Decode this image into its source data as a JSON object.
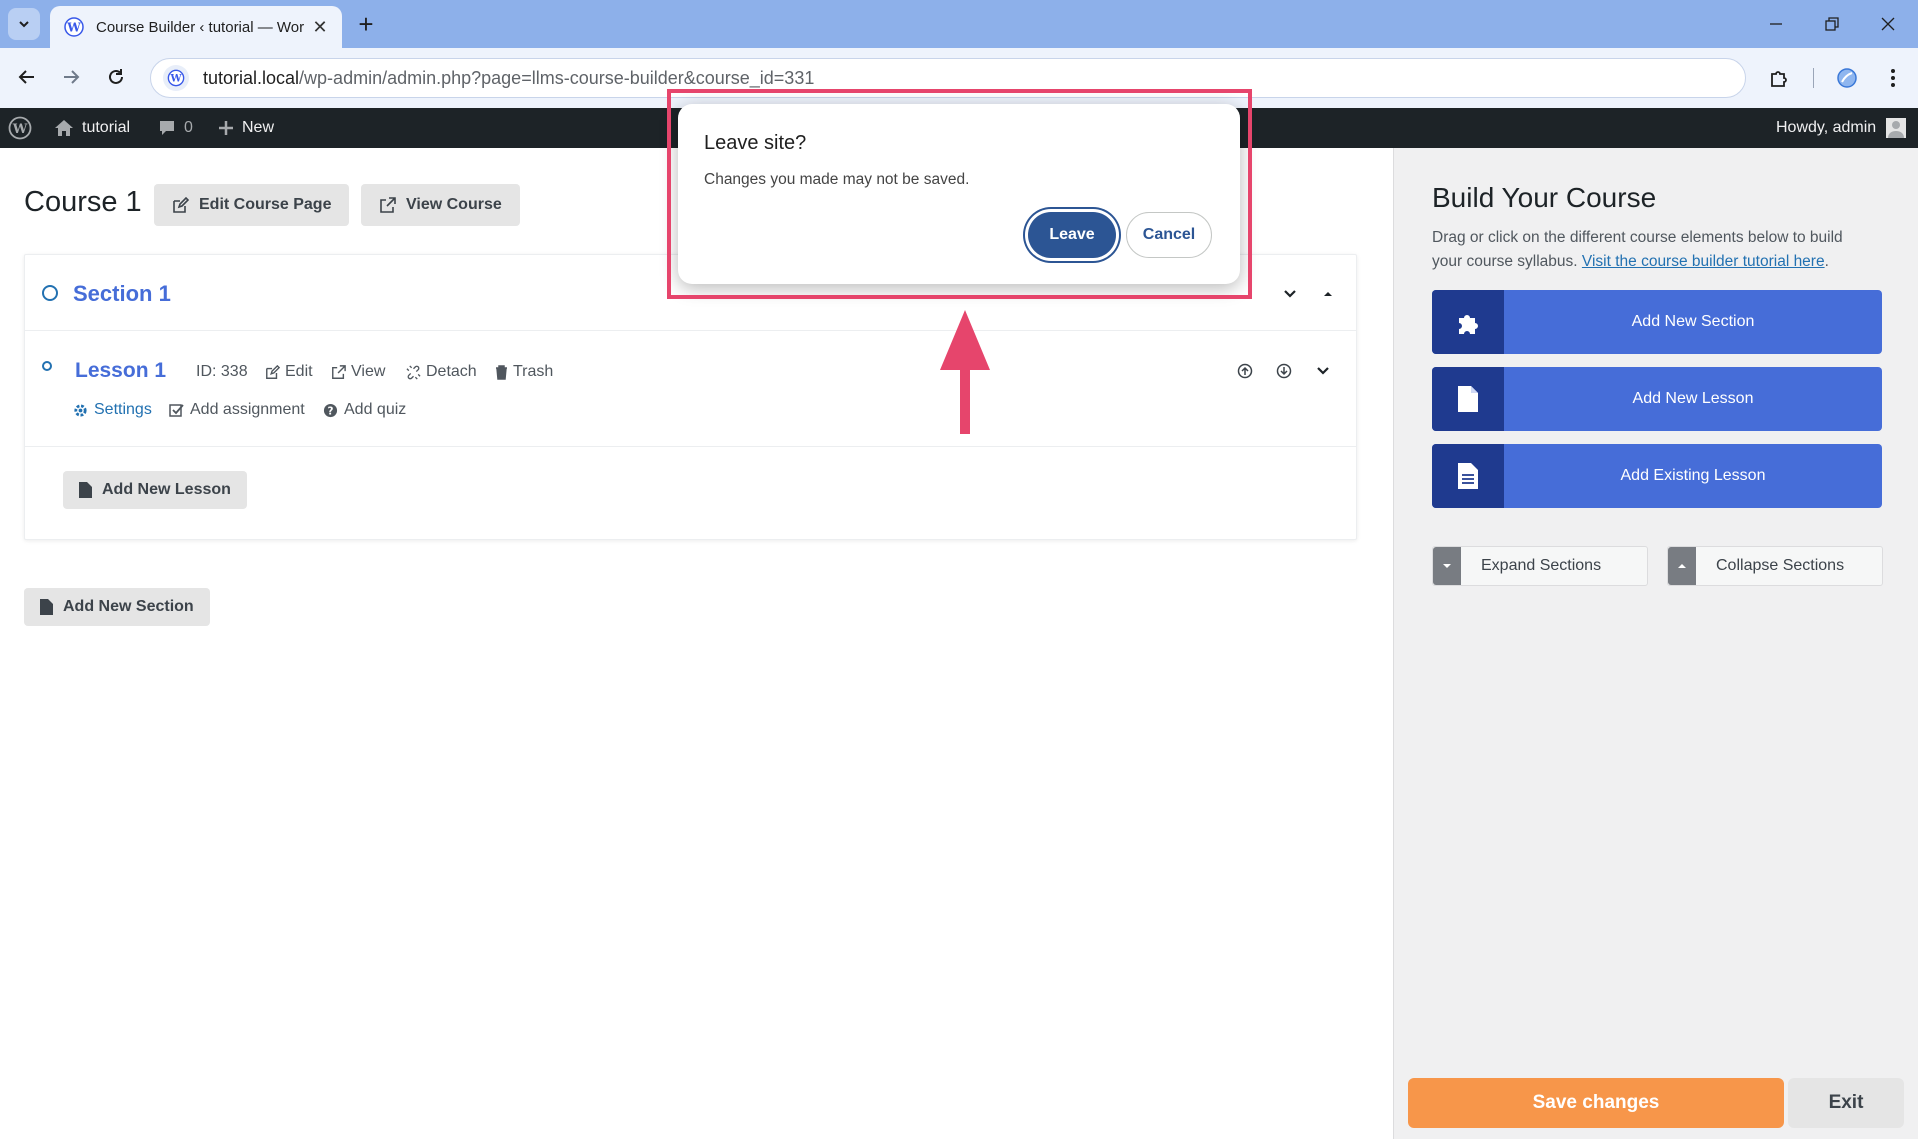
{
  "browser": {
    "tab_title": "Course Builder ‹ tutorial — Wor",
    "url_host": "tutorial.local",
    "url_path": "/wp-admin/admin.php?page=llms-course-builder&course_id=331"
  },
  "adminbar": {
    "site_name": "tutorial",
    "comments_count": "0",
    "new_label": "New",
    "howdy": "Howdy, admin"
  },
  "course": {
    "title": "Course 1",
    "edit_page_label": "Edit Course Page",
    "view_course_label": "View Course"
  },
  "section": {
    "name": "Section 1",
    "lesson": {
      "name": "Lesson 1",
      "id_label": "ID: 338",
      "edit": "Edit",
      "view": "View",
      "detach": "Detach",
      "trash": "Trash",
      "settings": "Settings",
      "add_assignment": "Add assignment",
      "add_quiz": "Add quiz"
    },
    "add_lesson_label": "Add New Lesson"
  },
  "add_section_label": "Add New Section",
  "sidebar": {
    "title": "Build Your Course",
    "desc": "Drag or click on the different course elements below to build your course syllabus.",
    "tutorial_link": "Visit the course builder tutorial here",
    "desc_end": ".",
    "buttons": [
      {
        "label": "Add New Section",
        "icon": "puzzle-icon"
      },
      {
        "label": "Add New Lesson",
        "icon": "file-icon"
      },
      {
        "label": "Add Existing Lesson",
        "icon": "file-text-icon"
      }
    ],
    "expand_label": "Expand Sections",
    "collapse_label": "Collapse Sections",
    "save_label": "Save changes",
    "exit_label": "Exit"
  },
  "dialog": {
    "title": "Leave site?",
    "message": "Changes you made may not be saved.",
    "leave_label": "Leave",
    "cancel_label": "Cancel"
  },
  "colors": {
    "accent": "#466dd8",
    "accent_dark": "#1f3a8f",
    "save": "#f7964a",
    "highlight": "#e6456c",
    "leave_button": "#2c5594"
  }
}
